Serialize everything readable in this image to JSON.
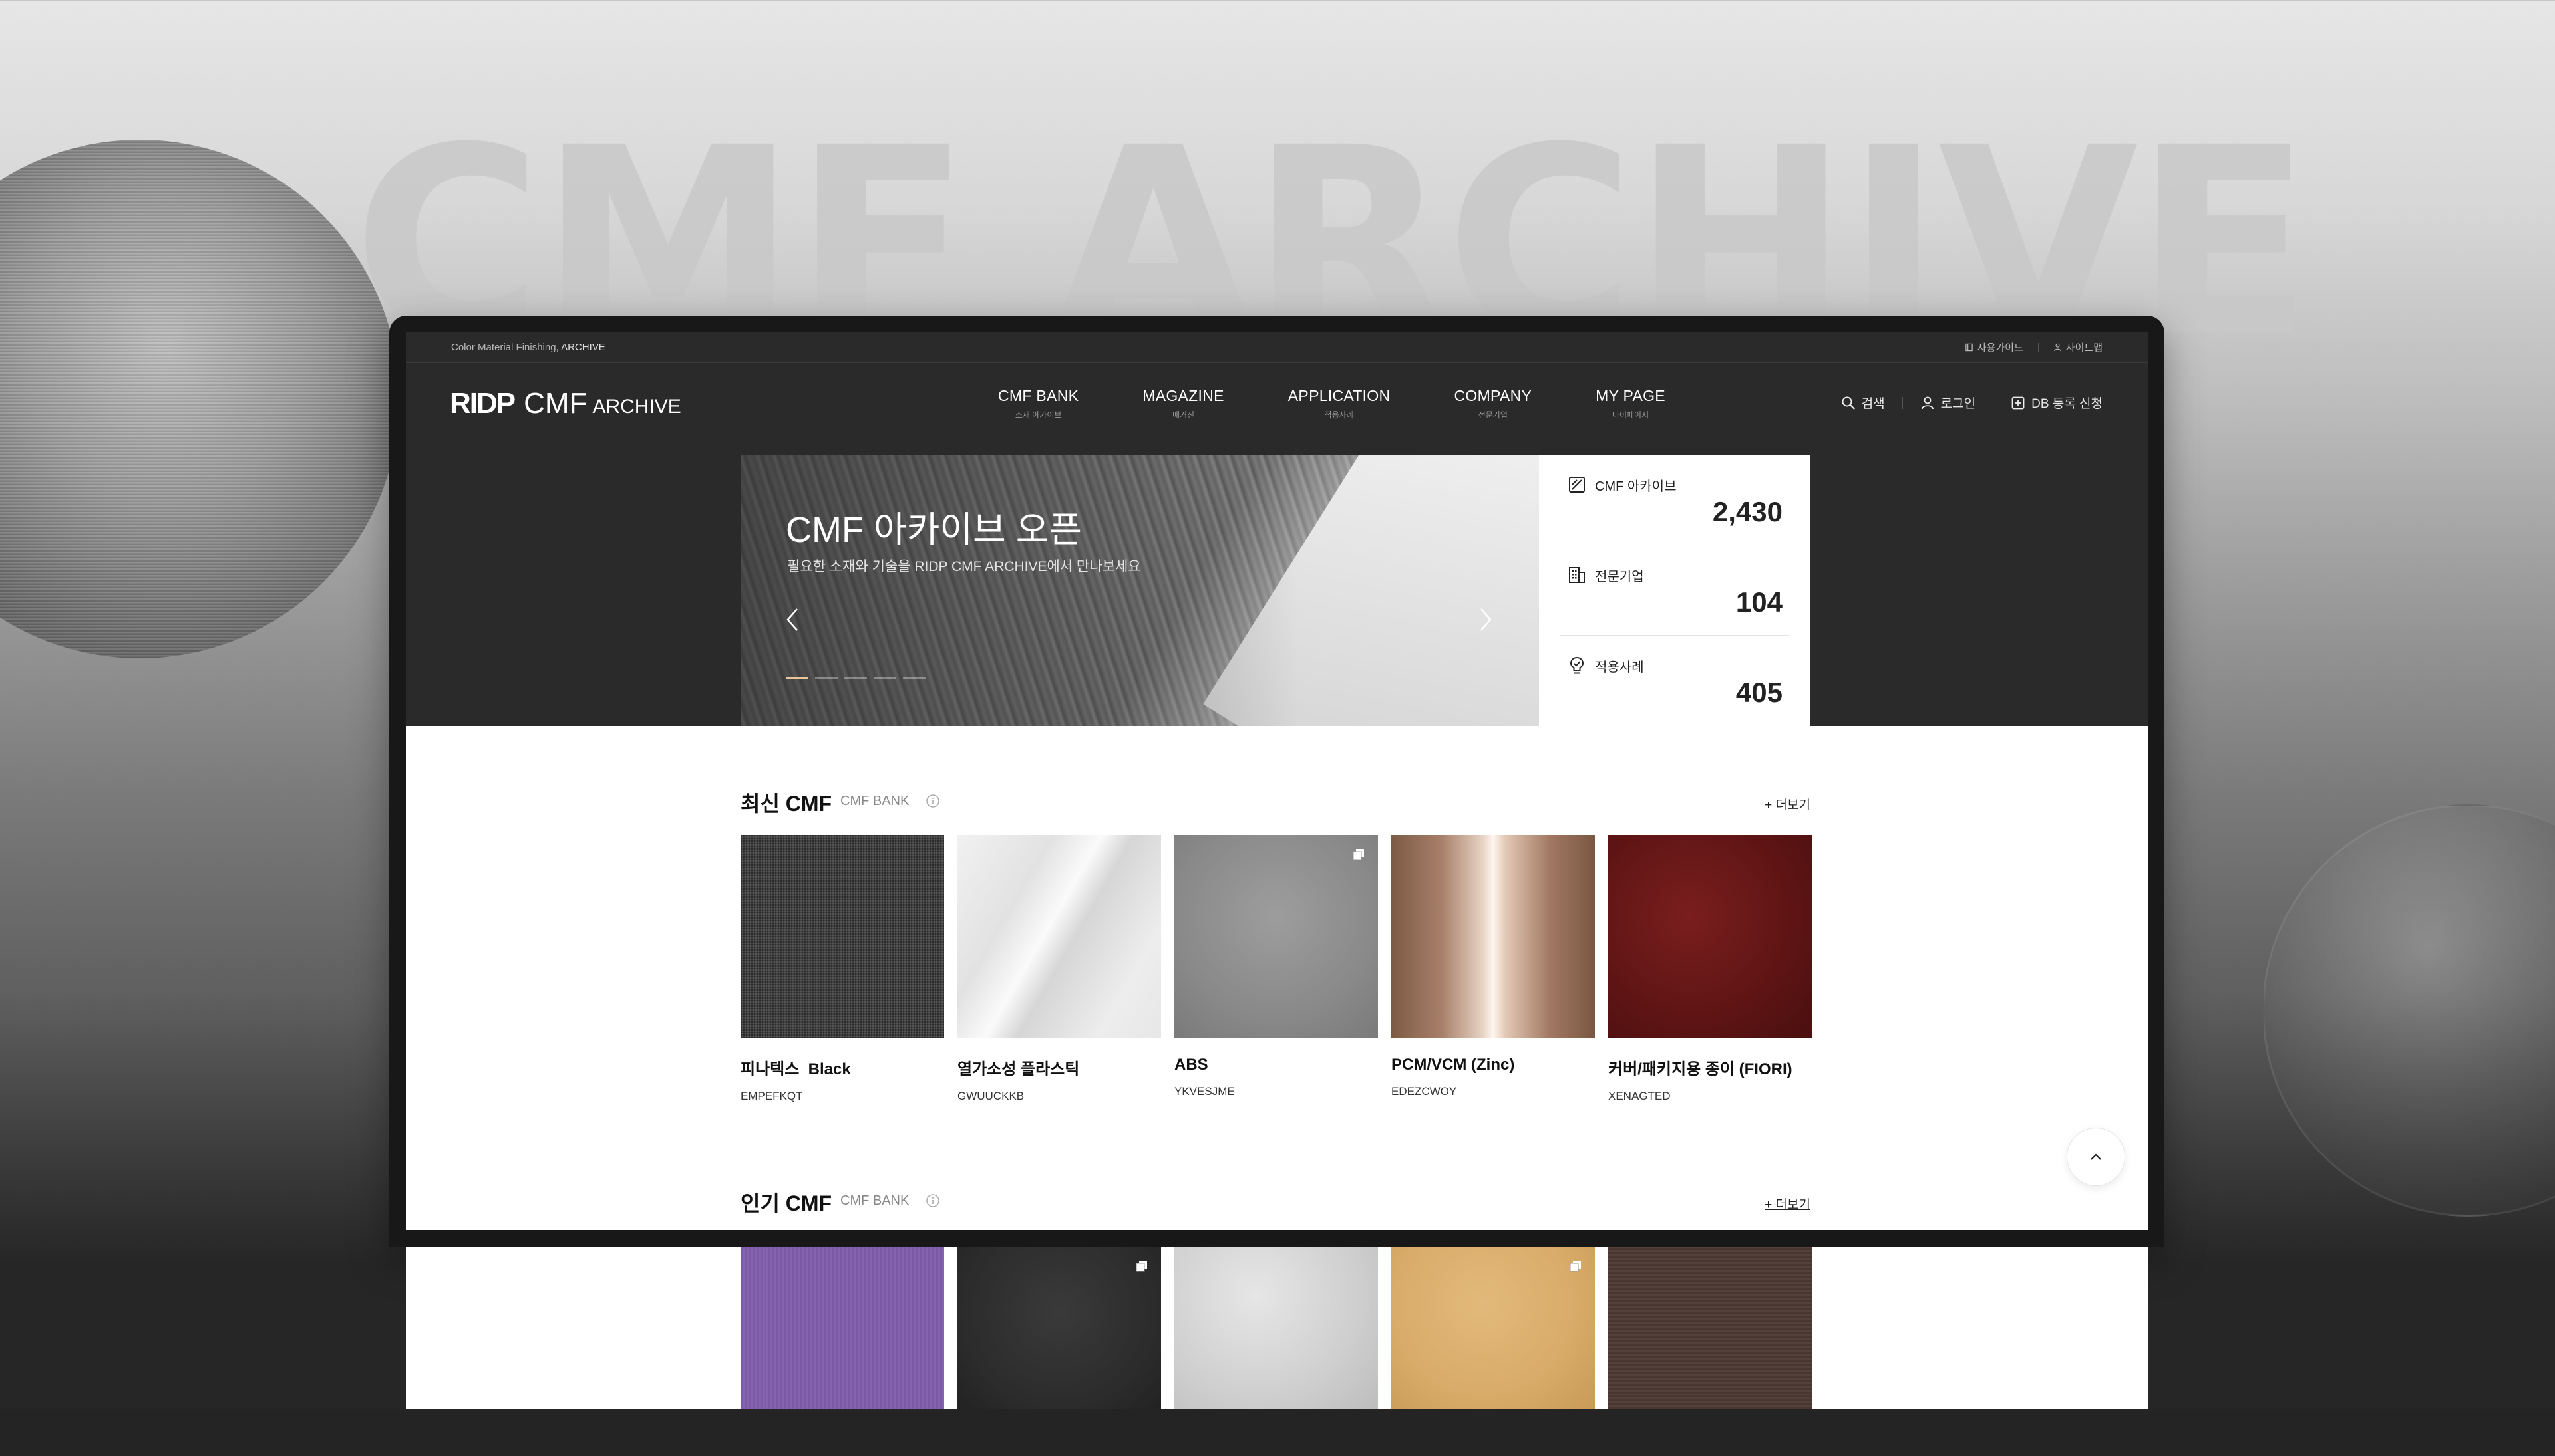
{
  "backdrop": {
    "headline": "CMF ARCHIVE"
  },
  "utility": {
    "brand_prefix": "Color Material Finishing, ",
    "brand_strong": "ARCHIVE",
    "links": [
      {
        "label": "사용가이드",
        "icon": "book-icon"
      },
      {
        "label": "사이트맵",
        "icon": "sitemap-icon"
      }
    ]
  },
  "header": {
    "logo": {
      "part1": "RIDP",
      "part2": "CMF",
      "part3": "ARCHIVE"
    },
    "nav": [
      {
        "en": "CMF BANK",
        "ko": "소재 아카이브"
      },
      {
        "en": "MAGAZINE",
        "ko": "매거진"
      },
      {
        "en": "APPLICATION",
        "ko": "적용사례"
      },
      {
        "en": "COMPANY",
        "ko": "전문기업"
      },
      {
        "en": "MY PAGE",
        "ko": "마이페이지"
      }
    ],
    "actions": {
      "search": "검색",
      "login": "로그인",
      "register": "DB 등록 신청"
    }
  },
  "hero": {
    "title": "CMF 아카이브 오픈",
    "subtitle": "필요한 소재와 기술을 RIDP CMF ARCHIVE에서 만나보세요",
    "slide_count": 5,
    "active_slide": 1
  },
  "stats": [
    {
      "label": "CMF 아카이브",
      "value": "2,430",
      "icon": "archive-icon"
    },
    {
      "label": "전문기업",
      "value": "104",
      "icon": "building-icon"
    },
    {
      "label": "적용사례",
      "value": "405",
      "icon": "lightbulb-icon"
    }
  ],
  "latest": {
    "title": "최신 CMF",
    "sub": "CMF BANK",
    "more": "+ 더보기",
    "items": [
      {
        "name": "피나텍스_Black",
        "code": "EMPEFKQT",
        "texture": "black-fabric"
      },
      {
        "name": "열가소성 플라스틱",
        "code": "GWUUCKKB",
        "texture": "white-plastic"
      },
      {
        "name": "ABS",
        "code": "YKVESJME",
        "texture": "grey-abs",
        "multi": true
      },
      {
        "name": "PCM/VCM (Zinc)",
        "code": "EDEZCWOY",
        "texture": "copper-metal"
      },
      {
        "name": "커버/패키지용 종이 (FIORI)",
        "code": "XENAGTED",
        "texture": "red-leather"
      }
    ]
  },
  "popular": {
    "title": "인기 CMF",
    "sub": "CMF BANK",
    "more": "+ 더보기",
    "items": [
      {
        "texture": "purple-fabric"
      },
      {
        "texture": "black-leather",
        "multi": true
      },
      {
        "texture": "silver-leather"
      },
      {
        "texture": "beige-leather",
        "multi": true
      },
      {
        "texture": "brown-fabric"
      }
    ]
  },
  "colors": {
    "dark_bg": "#2a2a2a",
    "accent_dot": "#e6c69a",
    "text_primary": "#111111"
  }
}
